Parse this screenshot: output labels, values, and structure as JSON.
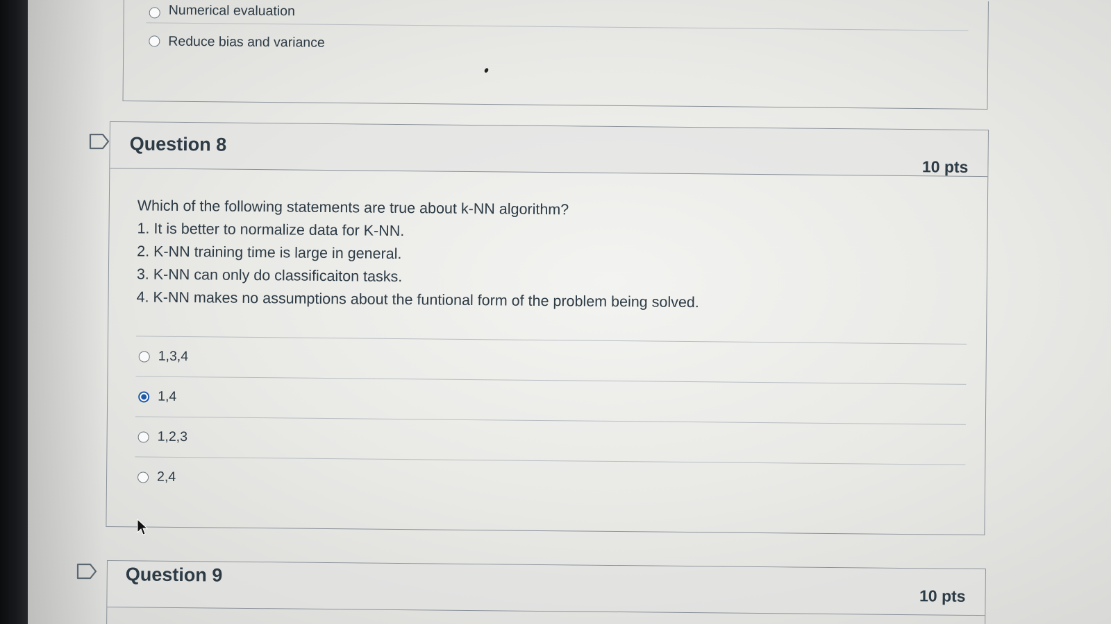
{
  "previous_question": {
    "options": [
      {
        "label": "Numerical evaluation",
        "selected": false
      },
      {
        "label": "Reduce bias and variance",
        "selected": false
      }
    ]
  },
  "question8": {
    "title": "Question 8",
    "points": "10 pts",
    "prompt": "Which of the following statements are true about k-NN algorithm?",
    "statements": [
      "1. It is better to normalize data for K-NN.",
      "2. K-NN training time is large in general.",
      "3. K-NN can only do classificaiton tasks.",
      "4. K-NN makes no assumptions about the funtional form of the problem being solved."
    ],
    "options": [
      {
        "label": "1,3,4",
        "selected": false
      },
      {
        "label": "1,4",
        "selected": true
      },
      {
        "label": "1,2,3",
        "selected": false
      },
      {
        "label": "2,4",
        "selected": false
      }
    ]
  },
  "question9": {
    "title": "Question 9",
    "points": "10 pts"
  },
  "colors": {
    "text": "#2d3b45",
    "border": "#8a9299",
    "radio_selected": "#1f5aa8"
  },
  "icons": {
    "flag": "bookmark-flag-icon",
    "radio": "radio-icon",
    "cursor": "mouse-pointer-icon"
  }
}
